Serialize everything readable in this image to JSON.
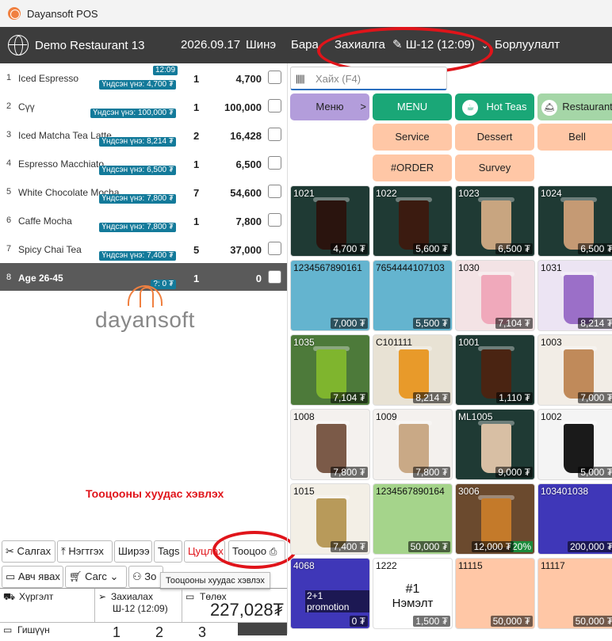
{
  "window": {
    "title": "Dayansoft POS"
  },
  "header": {
    "restaurant": "Demo Restaurant 13",
    "date": "2026.09.17",
    "new": "Шинэ",
    "goods": "Бара",
    "reservation": "Захиалга",
    "table": "Ш-12 (12:09)",
    "sales": "Борлуулалт"
  },
  "orders": [
    {
      "no": "1",
      "name": "Iced Espresso",
      "badge": "Үндсэн үнэ: 4,700 ₮",
      "qty": "1",
      "price": "4,700"
    },
    {
      "no": "2",
      "name": "Сүү",
      "badge": "Үндсэн үнэ: 100,000 ₮",
      "qty": "1",
      "price": "100,000"
    },
    {
      "no": "3",
      "name": "Iced Matcha Tea Latte",
      "badge": "Үндсэн үнэ: 8,214 ₮",
      "qty": "2",
      "price": "16,428"
    },
    {
      "no": "4",
      "name": "Espresso Macchiato",
      "badge": "Үндсэн үнэ: 6,500 ₮",
      "qty": "1",
      "price": "6,500"
    },
    {
      "no": "5",
      "name": "White  Chocolate Mocha",
      "badge": "Үндсэн үнэ: 7,800 ₮",
      "qty": "7",
      "price": "54,600"
    },
    {
      "no": "6",
      "name": "Caffe Mocha",
      "badge": "Үндсэн үнэ: 7,800 ₮",
      "qty": "1",
      "price": "7,800"
    },
    {
      "no": "7",
      "name": "Spicy Chai Tea",
      "badge": "Үндсэн үнэ: 7,400 ₮",
      "qty": "5",
      "price": "37,000"
    },
    {
      "no": "8",
      "name": "Age 26-45",
      "badge": "?: 0 ₮",
      "qty": "1",
      "price": "0"
    }
  ],
  "order_time": "12:09",
  "brand": "dayansoft",
  "print_caption": "Тооцооны хуудас хэвлэх",
  "actions": {
    "move": "Салгах",
    "merge": "Нэгтгэх",
    "table": "Ширээ",
    "tags": "Tags",
    "cancel": "Цуцлах",
    "bill": "Тооцоо",
    "takeaway": "Авч явах",
    "cart": "Сагс",
    "guest": "Зо"
  },
  "tooltip": "Тооцооны хуудас хэвлэх",
  "bottom": {
    "delivery": "Хүргэлт",
    "order_label": "Захиалах",
    "order_table": "Ш-12 (12:09)",
    "payment_label": "Төлөх",
    "total": "227,028₮",
    "customer": "Гишүүн",
    "n1": "1",
    "n2": "2",
    "n3": "3"
  },
  "search": {
    "placeholder": "Хайх (F4)",
    "barcode": "|||||"
  },
  "categories": [
    {
      "label": "Меню",
      "arrow": ">",
      "color": "#b39ddb"
    },
    {
      "label": "MENU",
      "color": "#1aa777"
    },
    {
      "label": "Hot Teas",
      "color": "#1aa777"
    },
    {
      "label": "Restaurant",
      "color": "#a5d6a7"
    },
    {
      "label": "Service",
      "color": "#ffc7a6"
    },
    {
      "label": "Dessert",
      "color": "#ffc7a6"
    },
    {
      "label": "Bell",
      "color": "#ffc7a6"
    },
    {
      "label": "#ORDER",
      "color": "#ffc7a6"
    },
    {
      "label": "Survey",
      "color": "#ffc7a6"
    }
  ],
  "products": [
    {
      "code": "1021",
      "price": "4,700 ₮",
      "bg": "#1f3a34",
      "drink": "#2a140e"
    },
    {
      "code": "1022",
      "price": "5,600 ₮",
      "bg": "#1f3a34",
      "drink": "#3b1b10"
    },
    {
      "code": "1023",
      "price": "6,500 ₮",
      "bg": "#1f3a34",
      "drink": "#c8a580"
    },
    {
      "code": "1024",
      "price": "6,500 ₮",
      "bg": "#1f3a34",
      "drink": "#c59a74"
    },
    {
      "code": "1234567890161",
      "price": "7,000 ₮",
      "bg": "#64b4cf",
      "drink": ""
    },
    {
      "code": "7654444107103",
      "price": "5,500 ₮",
      "bg": "#64b4cf",
      "drink": ""
    },
    {
      "code": "1030",
      "price": "7,104 ₮",
      "bg": "#f3e3e5",
      "drink": "#f0a9bb"
    },
    {
      "code": "1031",
      "price": "8,214 ₮",
      "bg": "#ece4f3",
      "drink": "#9b6fc8"
    },
    {
      "code": "1035",
      "price": "7,104 ₮",
      "bg": "#4d7a3a",
      "drink": "#7fb52e"
    },
    {
      "code": "C101111",
      "price": "8,214 ₮",
      "bg": "#e8e2d4",
      "drink": "#e89a2a"
    },
    {
      "code": "1001",
      "price": "1,110 ₮",
      "bg": "#1f3a34",
      "drink": "#4a2412"
    },
    {
      "code": "1003",
      "price": "7,000 ₮",
      "bg": "#f2ede6",
      "drink": "#c08a5a"
    },
    {
      "code": "1008",
      "price": "7,800 ₮",
      "bg": "#f4f1ee",
      "drink": "#7b5a48"
    },
    {
      "code": "1009",
      "price": "7,800 ₮",
      "bg": "#f4f1ee",
      "drink": "#c9a986"
    },
    {
      "code": "ML1005",
      "price": "9,000 ₮",
      "bg": "#1f3a34",
      "drink": "#d8bfa4"
    },
    {
      "code": "1002",
      "price": "5,000 ₮",
      "bg": "#f4f4f4",
      "drink": "#1a1a1a"
    },
    {
      "code": "1015",
      "price": "7,400 ₮",
      "bg": "#f3efe6",
      "drink": "#b89a5a"
    },
    {
      "code": "1234567890164",
      "price": "50,000 ₮",
      "bg": "#a5d48b",
      "drink": ""
    },
    {
      "code": "3006",
      "price": "12,000 ₮",
      "bg": "#6b4a2e",
      "drink": "#c47a2a",
      "discount": "20%"
    },
    {
      "code": "103401038",
      "price": "200,000 ₮",
      "bg": "#3f37b8",
      "drink": ""
    },
    {
      "code": "4068",
      "price": "0 ₮",
      "bg": "#3f37b8",
      "drink": "",
      "promo": "2+1 promotion"
    },
    {
      "code": "1222",
      "price": "1,500 ₮",
      "bg": "#ffffff",
      "drink": "",
      "center": "#1\nНэмэлт"
    },
    {
      "code": "11115",
      "price": "50,000 ₮",
      "bg": "#ffc7a6",
      "drink": ""
    },
    {
      "code": "11117",
      "price": "50,000 ₮",
      "bg": "#ffc7a6",
      "drink": ""
    }
  ]
}
